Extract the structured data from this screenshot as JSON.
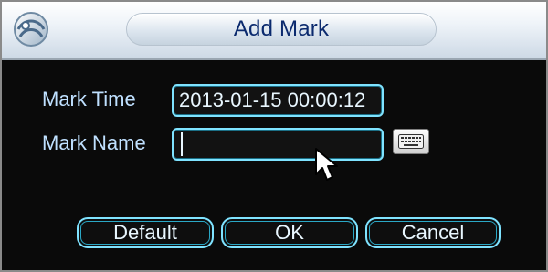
{
  "dialog": {
    "title": "Add Mark"
  },
  "form": {
    "mark_time_label": "Mark Time",
    "mark_time_value": "2013-01-15 00:00:12",
    "mark_name_label": "Mark Name",
    "mark_name_value": ""
  },
  "buttons": {
    "default_label": "Default",
    "ok_label": "OK",
    "cancel_label": "Cancel"
  },
  "icons": {
    "logo": "dvr-logo-icon",
    "keyboard": "keyboard-icon",
    "cursor": "mouse-pointer-icon"
  },
  "colors": {
    "title_text": "#0b2a6e",
    "label_text": "#bfe0ff",
    "field_border": "#7fe3ff",
    "content_bg": "#0a0a0a"
  }
}
